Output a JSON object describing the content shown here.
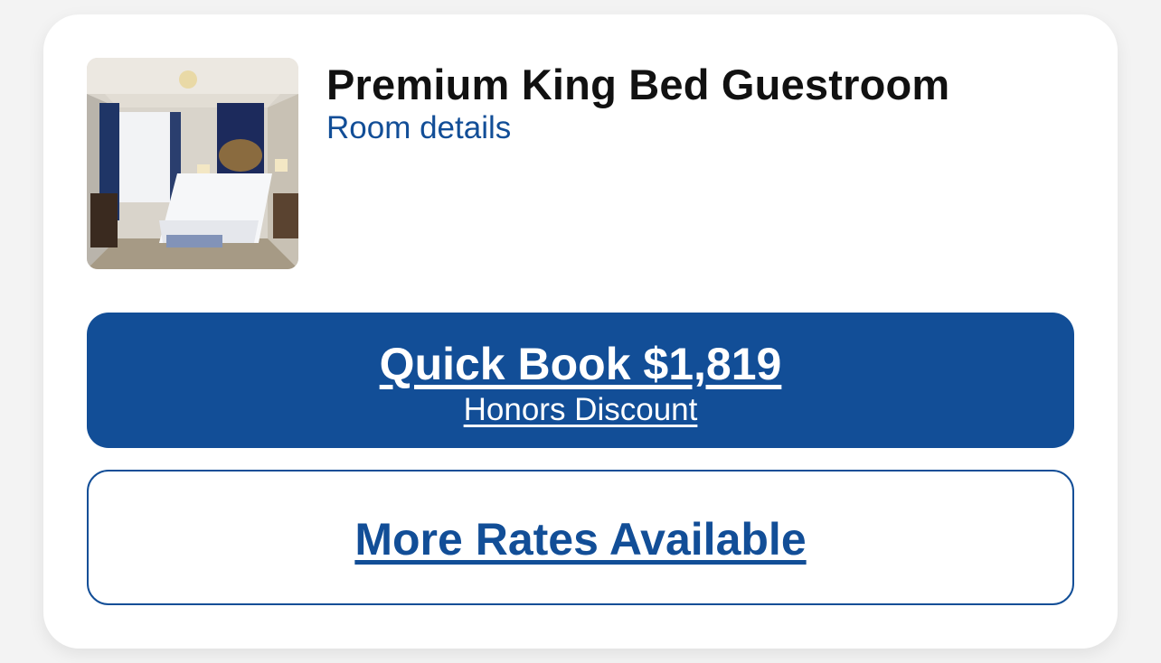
{
  "room": {
    "title": "Premium King Bed Guestroom",
    "details_link": "Room details",
    "image_icon": "room-photo"
  },
  "quick_book": {
    "label": "Quick Book $1,819",
    "sublabel": "Honors Discount"
  },
  "more_rates": {
    "label": "More Rates Available"
  },
  "colors": {
    "brand_blue": "#124e97",
    "background": "#f3f3f3",
    "card": "#ffffff"
  }
}
